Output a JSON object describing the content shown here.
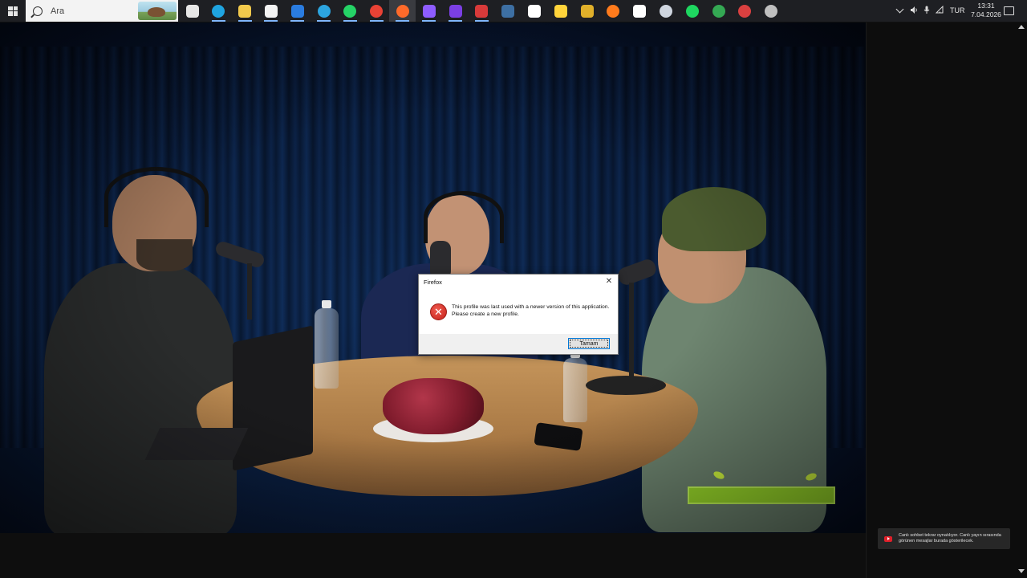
{
  "taskbar": {
    "search_placeholder": "Ara",
    "language": "TUR",
    "time": "13:31",
    "date": "7.04.2026",
    "apps": [
      {
        "name": "task-view-icon",
        "color": "#e6e6e6"
      },
      {
        "name": "edge-icon",
        "color": "#1fa4e0"
      },
      {
        "name": "file-explorer-icon",
        "color": "#f2c94c"
      },
      {
        "name": "store-icon",
        "color": "#f3f3f3"
      },
      {
        "name": "mail-icon",
        "color": "#2a7ce0"
      },
      {
        "name": "telegram-icon",
        "color": "#2ca5e0"
      },
      {
        "name": "whatsapp-icon",
        "color": "#25d366"
      },
      {
        "name": "chrome-icon",
        "color": "#e94235"
      },
      {
        "name": "firefox-icon",
        "color": "#ff6a2a"
      },
      {
        "name": "drop-icon",
        "color": "#8e5cff"
      },
      {
        "name": "clapper-icon",
        "color": "#7b3fe4"
      },
      {
        "name": "red-app-icon",
        "color": "#d83a3a"
      },
      {
        "name": "steam-icon",
        "color": "#3d6fa3"
      },
      {
        "name": "document-icon",
        "color": "#ffffff"
      },
      {
        "name": "sticky-notes-icon",
        "color": "#ffd43b"
      },
      {
        "name": "puzzle-app-icon",
        "color": "#e0b02a"
      },
      {
        "name": "ember-icon",
        "color": "#ff7b1c"
      },
      {
        "name": "blank-document-icon",
        "color": "#ffffff"
      },
      {
        "name": "disc-icon",
        "color": "#cfd6e0"
      },
      {
        "name": "spotify-icon",
        "color": "#1ed760"
      },
      {
        "name": "chrome-profile-icon",
        "color": "#34a853"
      },
      {
        "name": "record-app-icon",
        "color": "#d94040"
      },
      {
        "name": "gray-app-icon",
        "color": "#bfbfbf"
      }
    ]
  },
  "dialog": {
    "title": "Firefox",
    "message": "This profile was last used with a newer version of this application. Please create a new profile.",
    "ok_label": "Tamam"
  },
  "chat": {
    "message": "Canlı sohbet tekrar oynatılıyor. Canlı yayın sırasında görünen mesajlar burada gösterilecek."
  }
}
